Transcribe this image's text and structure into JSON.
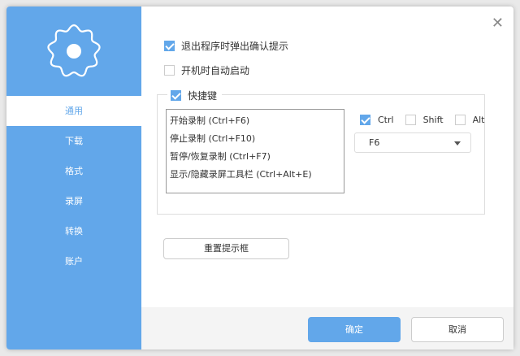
{
  "sidebar": {
    "items": [
      "通用",
      "下载",
      "格式",
      "录屏",
      "转换",
      "账户"
    ],
    "selected": 0,
    "logo_icon": "flower-gear-icon"
  },
  "options": {
    "confirm_exit": {
      "label": "退出程序时弹出确认提示",
      "checked": true
    },
    "auto_start": {
      "label": "开机时自动启动",
      "checked": false
    }
  },
  "hotkeys": {
    "label": "快捷键",
    "checked": true,
    "list": [
      "开始录制 (Ctrl+F6)",
      "停止录制 (Ctrl+F10)",
      "暂停/恢复录制 (Ctrl+F7)",
      "显示/隐藏录屏工具栏 (Ctrl+Alt+E)"
    ],
    "ctrl": {
      "label": "Ctrl",
      "checked": true
    },
    "shift": {
      "label": "Shift",
      "checked": false
    },
    "alt": {
      "label": "Alt",
      "checked": false
    },
    "key": "F6"
  },
  "reset_label": "重置提示框",
  "footer": {
    "ok": "确定",
    "cancel": "取消"
  },
  "colors": {
    "accent": "#62a7ea"
  }
}
